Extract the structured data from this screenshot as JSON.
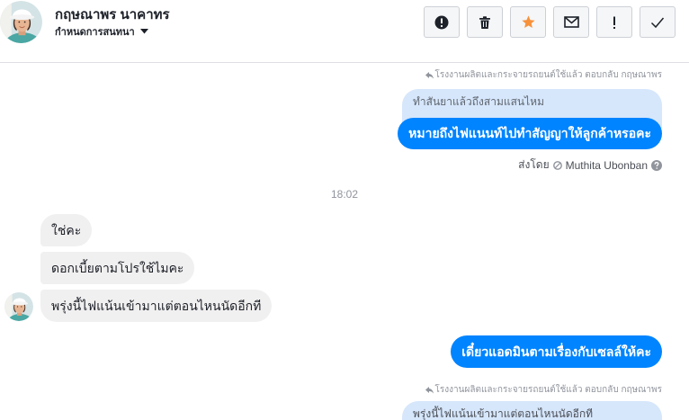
{
  "contact": {
    "name": "กฤษณาพร นาคาทร",
    "conversation_menu": "กำหนดการสนทนา"
  },
  "toolbar": {
    "actions": [
      {
        "icon": "exclamation-circle-icon"
      },
      {
        "icon": "trash-icon"
      },
      {
        "icon": "star-icon",
        "starred": true
      },
      {
        "icon": "envelope-icon"
      },
      {
        "icon": "exclamation-icon"
      },
      {
        "icon": "checkmark-icon"
      }
    ]
  },
  "conversation": {
    "block_1": {
      "reply_notice": "โรงงานผลิตและกระจายรถยนต์ใช้แล้ว ตอบกลับ กฤษณาพร",
      "quoted_message": "ทำสันยาแล้วถึงสามแสนไหม",
      "message": "หมายถึงไฟแนนท์ไปทำสัญญาให้ลูกค้าหรอคะ",
      "sent_by_label": "ส่งโดย",
      "sent_by_name": "Muthita Ubonban"
    },
    "timestamp": "18:02",
    "incoming_messages": [
      "ใช่คะ",
      "ดอกเบี้ยตามโปรใช้ไมคะ",
      "พรุ่งนี้ไฟแน้นเข้ามาแต่ตอนไหนนัดอีกที"
    ],
    "block_2": {
      "message": "เดี๋ยวแอดมินตามเรื่องกับเซลล์ให้คะ"
    },
    "block_3": {
      "reply_notice": "โรงงานผลิตและกระจายรถยนต์ใช้แล้ว ตอบกลับ กฤษณาพร",
      "quoted_message": "พรุ่งนี้ไฟแน้นเข้ามาแต่ตอนไหนนัดอีกที"
    }
  },
  "colors": {
    "outgoing_bubble": "#0084ff",
    "incoming_bubble": "#f1f0f0",
    "quoted_bubble": "#d6e6fb",
    "starred": "#f7923b",
    "muted_text": "#90949c",
    "divider": "#dddfe2"
  }
}
